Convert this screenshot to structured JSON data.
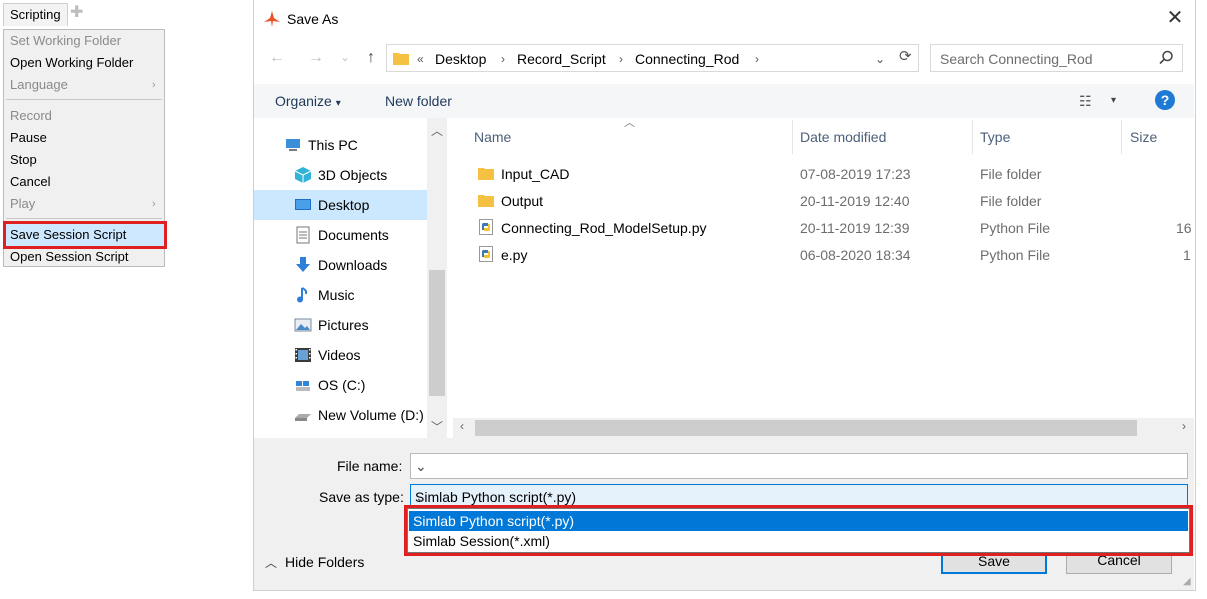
{
  "scripting_menu": {
    "tab_label": "Scripting",
    "items": [
      {
        "label": "Set Working Folder",
        "disabled": true
      },
      {
        "label": "Open Working Folder",
        "disabled": false
      },
      {
        "label": "Language",
        "disabled": true,
        "submenu": true
      },
      {
        "label": "Record",
        "disabled": true
      },
      {
        "label": "Pause",
        "disabled": false
      },
      {
        "label": "Stop",
        "disabled": false
      },
      {
        "label": "Cancel",
        "disabled": false
      },
      {
        "label": "Play",
        "disabled": true,
        "submenu": true
      },
      {
        "label": "Save Session Script",
        "highlighted": true
      },
      {
        "label": "Open Session Script",
        "disabled": false
      }
    ]
  },
  "dialog": {
    "title": "Save As",
    "close_icon": "close-icon",
    "address": {
      "overflow": "«",
      "segments": [
        "Desktop",
        "Record_Script",
        "Connecting_Rod"
      ]
    },
    "search_placeholder": "Search Connecting_Rod",
    "toolbar": {
      "organize": "Organize",
      "new_folder": "New folder",
      "help": "?"
    },
    "nav_items": [
      {
        "label": "This PC",
        "icon": "computer-icon"
      },
      {
        "label": "3D Objects",
        "icon": "cube-icon"
      },
      {
        "label": "Desktop",
        "icon": "desktop-icon",
        "selected": true
      },
      {
        "label": "Documents",
        "icon": "document-icon"
      },
      {
        "label": "Downloads",
        "icon": "download-icon"
      },
      {
        "label": "Music",
        "icon": "music-icon"
      },
      {
        "label": "Pictures",
        "icon": "picture-icon"
      },
      {
        "label": "Videos",
        "icon": "video-icon"
      },
      {
        "label": "OS (C:)",
        "icon": "drive-icon"
      },
      {
        "label": "New Volume (D:)",
        "icon": "drive-icon"
      }
    ],
    "columns": [
      "Name",
      "Date modified",
      "Type",
      "Size"
    ],
    "files": [
      {
        "name": "Input_CAD",
        "date": "07-08-2019 17:23",
        "type": "File folder",
        "size": "",
        "icon": "folder-icon"
      },
      {
        "name": "Output",
        "date": "20-11-2019 12:40",
        "type": "File folder",
        "size": "",
        "icon": "folder-icon"
      },
      {
        "name": "Connecting_Rod_ModelSetup.py",
        "date": "20-11-2019 12:39",
        "type": "Python File",
        "size": "16",
        "icon": "python-file-icon"
      },
      {
        "name": "e.py",
        "date": "06-08-2020 18:34",
        "type": "Python File",
        "size": "1",
        "icon": "python-file-icon"
      }
    ],
    "file_name_label": "File name:",
    "file_name_value": "",
    "save_type_label": "Save as type:",
    "save_type_value": "Simlab Python script(*.py)",
    "save_type_options": [
      "Simlab Python script(*.py)",
      "Simlab Session(*.xml)"
    ],
    "hide_folders": "Hide Folders",
    "save_button": "Save",
    "cancel_button": "Cancel"
  },
  "colors": {
    "accent": "#0078d7",
    "highlight": "#e02020",
    "selection": "#cce8ff"
  }
}
